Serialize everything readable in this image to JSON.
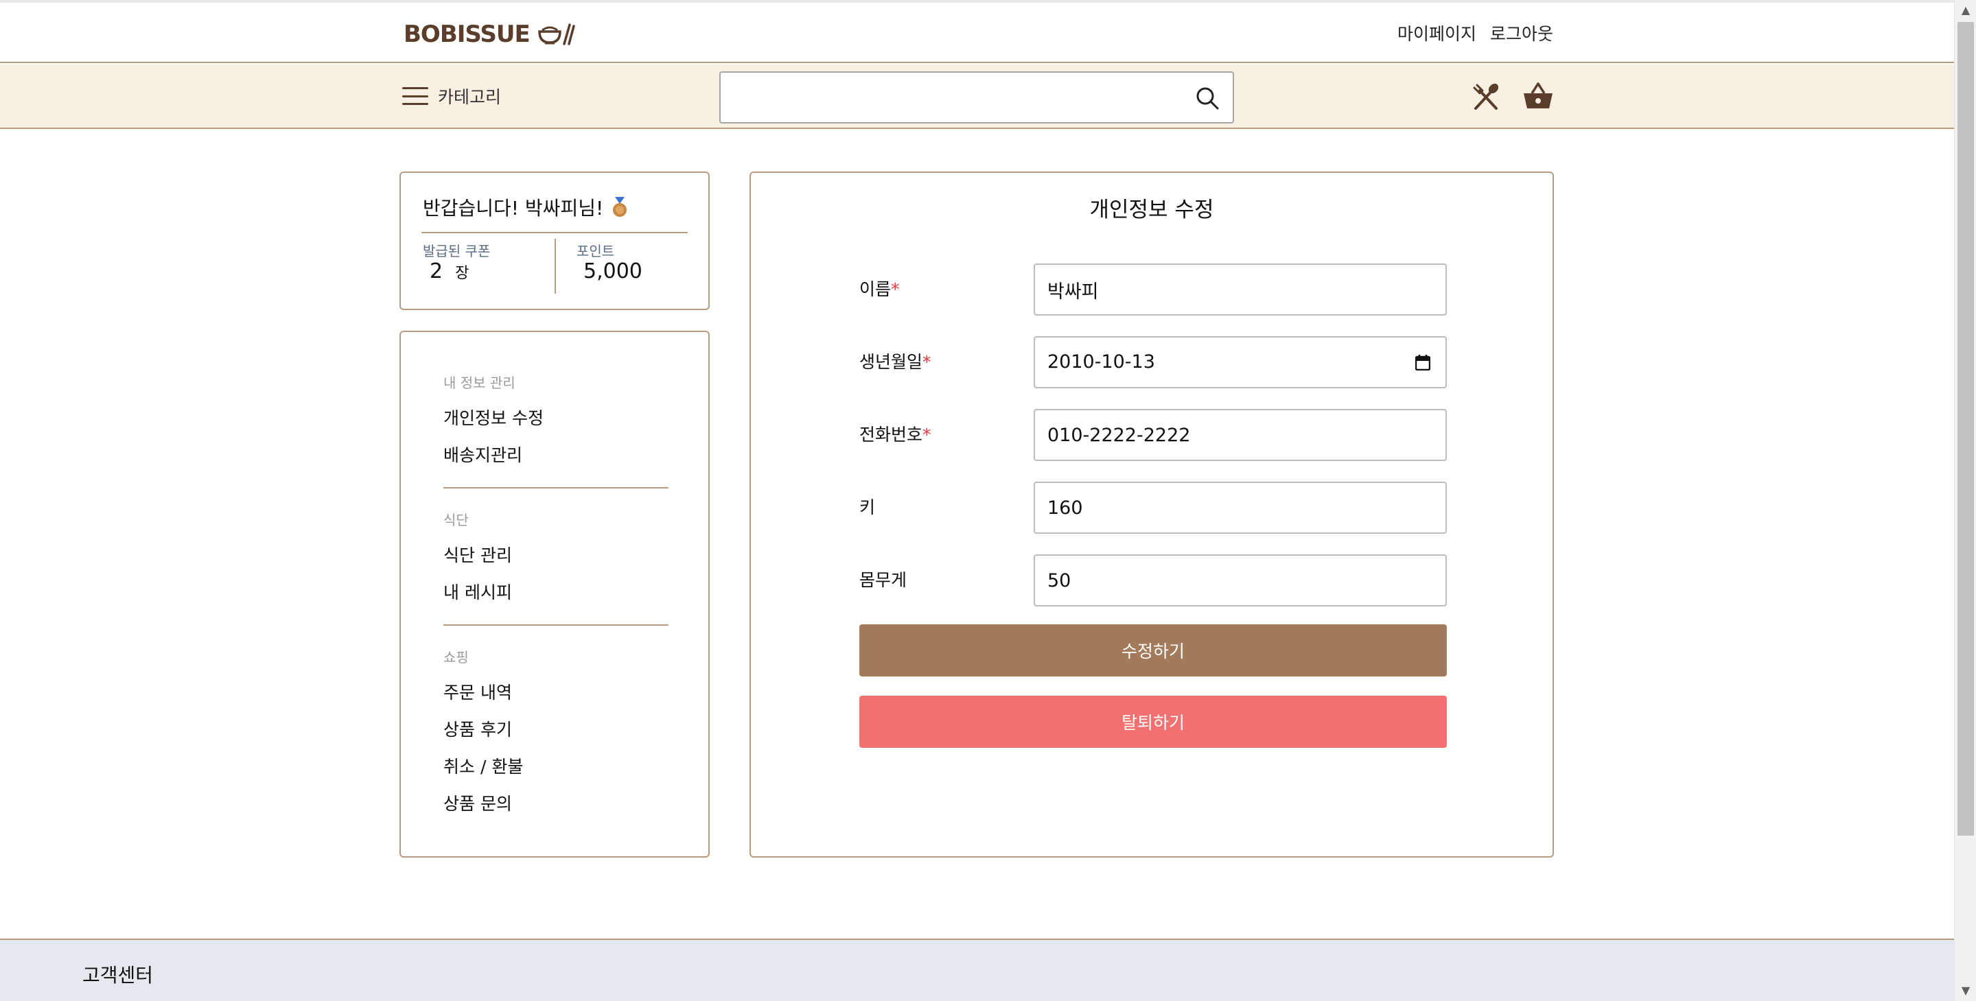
{
  "header": {
    "logo_text": "BOBISSUE",
    "links": {
      "mypage": "마이페이지",
      "logout": "로그아웃"
    }
  },
  "navbar": {
    "category_label": "카테고리",
    "search": {
      "value": "",
      "placeholder": ""
    }
  },
  "profile": {
    "greeting": "반갑습니다! 박싸피님!",
    "coupon_label": "발급된 쿠폰",
    "coupon_count": "2",
    "coupon_unit": "장",
    "point_label": "포인트",
    "point_value": "5,000"
  },
  "side_menu": {
    "sections": [
      {
        "title": "내 정보 관리",
        "items": [
          "개인정보 수정",
          "배송지관리"
        ]
      },
      {
        "title": "식단",
        "items": [
          "식단 관리",
          "내 레시피"
        ]
      },
      {
        "title": "쇼핑",
        "items": [
          "주문 내역",
          "상품 후기",
          "취소 / 환불",
          "상품 문의"
        ]
      }
    ]
  },
  "form": {
    "title": "개인정보 수정",
    "required_mark": "*",
    "fields": {
      "name": {
        "label": "이름",
        "value": "박싸피"
      },
      "birth": {
        "label": "생년월일",
        "value": "2010-10-13"
      },
      "phone": {
        "label": "전화번호",
        "value": "010-2222-2222"
      },
      "height": {
        "label": "키",
        "value": "160"
      },
      "weight": {
        "label": "몸무게",
        "value": "50"
      }
    },
    "save_label": "수정하기",
    "withdraw_label": "탈퇴하기"
  },
  "footer": {
    "title": "고객센터"
  },
  "colors": {
    "brand_brown": "#5a3d2b",
    "accent_brown": "#a37a5a",
    "border": "#b89a80",
    "nav_bg": "#f9f0e4",
    "danger": "#f27070",
    "footer_bg": "#e4e9ef"
  }
}
